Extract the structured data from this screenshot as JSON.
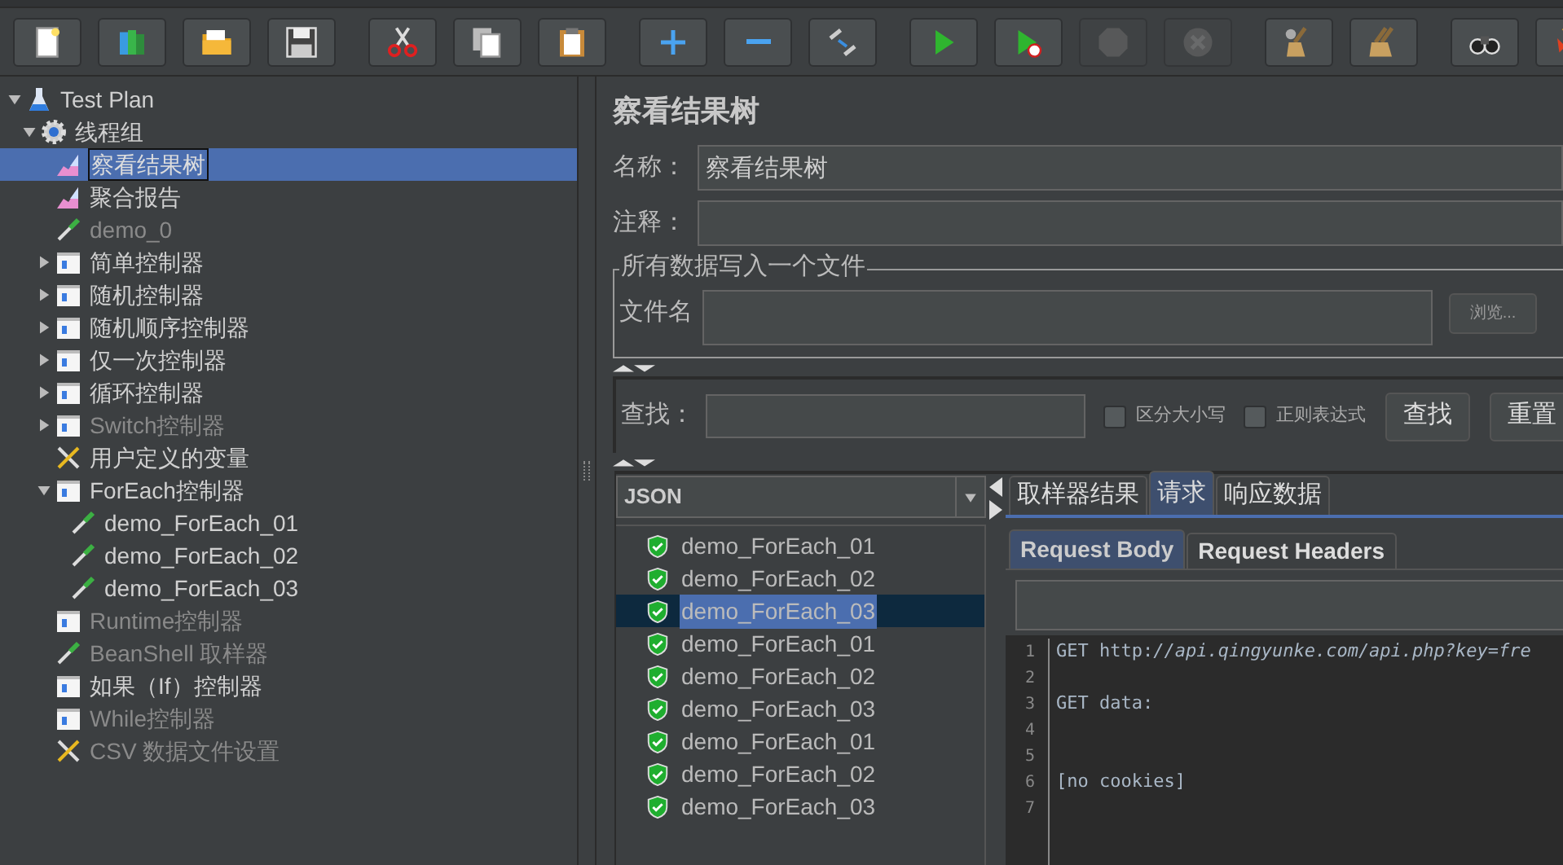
{
  "toolbar": [
    [
      {
        "kind": "new",
        "disabled": false
      },
      {
        "kind": "templates",
        "disabled": false
      },
      {
        "kind": "open",
        "disabled": false
      },
      {
        "kind": "save",
        "disabled": false
      }
    ],
    [
      {
        "kind": "cut",
        "disabled": false
      },
      {
        "kind": "copy",
        "disabled": false
      },
      {
        "kind": "paste",
        "disabled": false
      }
    ],
    [
      {
        "kind": "expand",
        "disabled": false
      },
      {
        "kind": "collapse",
        "disabled": false
      },
      {
        "kind": "toggle",
        "disabled": false
      }
    ],
    [
      {
        "kind": "start",
        "disabled": false
      },
      {
        "kind": "start-no-timers",
        "disabled": false
      },
      {
        "kind": "stop",
        "disabled": true
      },
      {
        "kind": "shutdown",
        "disabled": true
      }
    ],
    [
      {
        "kind": "clear",
        "disabled": false
      },
      {
        "kind": "clear-all",
        "disabled": false
      }
    ],
    [
      {
        "kind": "search",
        "disabled": false
      },
      {
        "kind": "reset",
        "disabled": false
      }
    ]
  ],
  "tree": [
    {
      "label": "Test Plan",
      "kind": "plan",
      "expanded": true,
      "selected": false,
      "disabled": false,
      "children": [
        {
          "label": "线程组",
          "kind": "threads",
          "expanded": true,
          "selected": false,
          "disabled": false,
          "children": [
            {
              "label": "察看结果树",
              "kind": "listener",
              "selected": true,
              "disabled": false
            },
            {
              "label": "聚合报告",
              "kind": "listener",
              "selected": false,
              "disabled": false
            },
            {
              "label": "demo_0",
              "kind": "sampler",
              "selected": false,
              "disabled": true
            },
            {
              "label": "简单控制器",
              "kind": "controller",
              "expanded": false,
              "selected": false,
              "disabled": false
            },
            {
              "label": "随机控制器",
              "kind": "controller",
              "expanded": false,
              "selected": false,
              "disabled": false
            },
            {
              "label": "随机顺序控制器",
              "kind": "controller",
              "expanded": false,
              "selected": false,
              "disabled": false
            },
            {
              "label": "仅一次控制器",
              "kind": "controller",
              "expanded": false,
              "selected": false,
              "disabled": false
            },
            {
              "label": "循环控制器",
              "kind": "controller",
              "expanded": false,
              "selected": false,
              "disabled": false
            },
            {
              "label": "Switch控制器",
              "kind": "controller",
              "expanded": false,
              "selected": false,
              "disabled": true
            },
            {
              "label": "用户定义的变量",
              "kind": "config",
              "selected": false,
              "disabled": false
            },
            {
              "label": "ForEach控制器",
              "kind": "controller",
              "expanded": true,
              "selected": false,
              "disabled": false,
              "children": [
                {
                  "label": "demo_ForEach_01",
                  "kind": "sampler",
                  "selected": false,
                  "disabled": false
                },
                {
                  "label": "demo_ForEach_02",
                  "kind": "sampler",
                  "selected": false,
                  "disabled": false
                },
                {
                  "label": "demo_ForEach_03",
                  "kind": "sampler",
                  "selected": false,
                  "disabled": false
                }
              ]
            },
            {
              "label": "Runtime控制器",
              "kind": "controller",
              "selected": false,
              "disabled": true
            },
            {
              "label": "BeanShell 取样器",
              "kind": "sampler",
              "selected": false,
              "disabled": true
            },
            {
              "label": "如果（If）控制器",
              "kind": "controller",
              "selected": false,
              "disabled": false
            },
            {
              "label": "While控制器",
              "kind": "controller",
              "selected": false,
              "disabled": true
            },
            {
              "label": "CSV 数据文件设置",
              "kind": "config",
              "selected": false,
              "disabled": true
            }
          ]
        }
      ]
    }
  ],
  "panel": {
    "title": "察看结果树",
    "name_label": "名称：",
    "name_value": "察看结果树",
    "comment_label": "注释：",
    "file_group": {
      "legend": "所有数据写入一个文件",
      "label": "文件名",
      "browse_button": "浏览..."
    },
    "search": {
      "label": "查找：",
      "options": [
        {
          "label": "区分大小写",
          "checked": false
        },
        {
          "label": "正则表达式",
          "checked": false
        }
      ],
      "buttons": [
        "查找",
        "重置"
      ]
    }
  },
  "results": {
    "renderer": "JSON",
    "items": [
      {
        "label": "demo_ForEach_01",
        "selected": false
      },
      {
        "label": "demo_ForEach_02",
        "selected": false
      },
      {
        "label": "demo_ForEach_03",
        "selected": true
      },
      {
        "label": "demo_ForEach_01",
        "selected": false
      },
      {
        "label": "demo_ForEach_02",
        "selected": false
      },
      {
        "label": "demo_ForEach_03",
        "selected": false
      },
      {
        "label": "demo_ForEach_01",
        "selected": false
      },
      {
        "label": "demo_ForEach_02",
        "selected": false
      },
      {
        "label": "demo_ForEach_03",
        "selected": false
      }
    ]
  },
  "tabs": [
    {
      "label": "取样器结果",
      "selected": false
    },
    {
      "label": "请求",
      "selected": true
    },
    {
      "label": "响应数据",
      "selected": false
    }
  ],
  "subtabs": [
    {
      "label": "Request Body",
      "selected": true
    },
    {
      "label": "Request Headers",
      "selected": false
    }
  ],
  "code_lines": [
    {
      "number": "1",
      "text": "GET http:*//api.qingyunke.com/api.php?key=fre*"
    },
    {
      "number": "2"
    },
    {
      "number": "3",
      "text": "GET data:"
    },
    {
      "number": "4"
    },
    {
      "number": "5"
    },
    {
      "number": "6",
      "text": "[no cookies]"
    },
    {
      "number": "7"
    }
  ]
}
